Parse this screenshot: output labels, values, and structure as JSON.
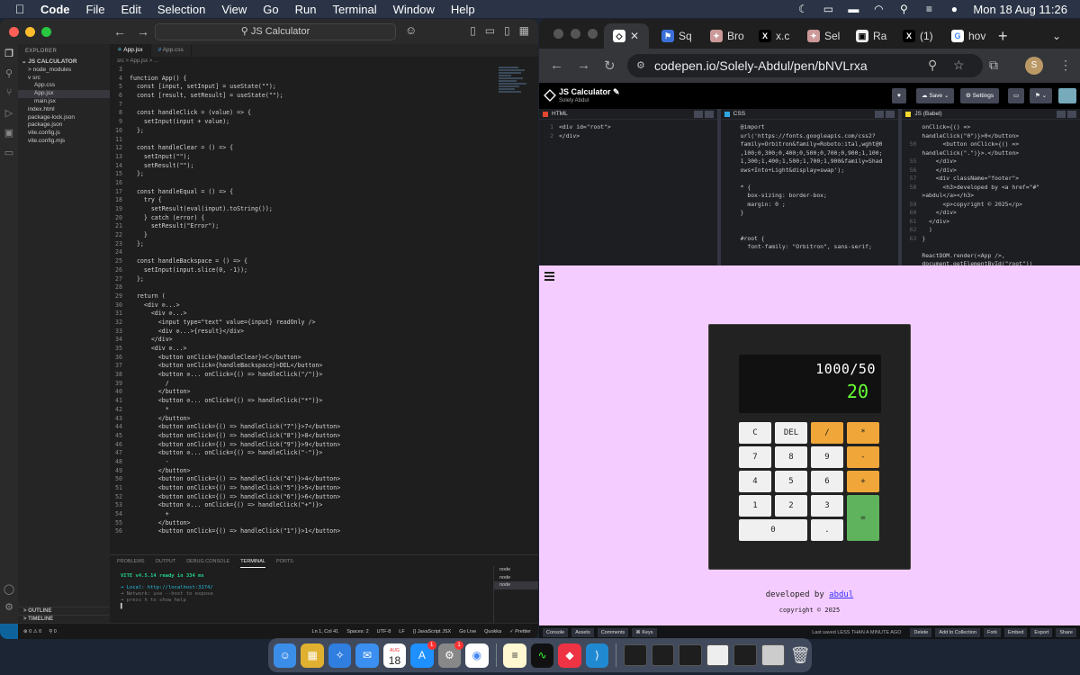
{
  "menubar": {
    "items": [
      "Code",
      "File",
      "Edit",
      "Selection",
      "View",
      "Go",
      "Run",
      "Terminal",
      "Window",
      "Help"
    ],
    "clock": "Mon 18 Aug  11:26"
  },
  "vscode": {
    "search": "JS Calculator",
    "explorer_header": "EXPLORER",
    "project": "JS CALCULATOR",
    "tree": [
      {
        "label": "node_modules",
        "indent": 1,
        "arrow": ">"
      },
      {
        "label": "src",
        "indent": 1,
        "arrow": "v"
      },
      {
        "label": "App.css",
        "indent": 2,
        "arrow": ""
      },
      {
        "label": "App.jsx",
        "indent": 2,
        "arrow": "",
        "active": true
      },
      {
        "label": "main.jsx",
        "indent": 2,
        "arrow": ""
      },
      {
        "label": "index.html",
        "indent": 1,
        "arrow": ""
      },
      {
        "label": "package-lock.json",
        "indent": 1,
        "arrow": ""
      },
      {
        "label": "package.json",
        "indent": 1,
        "arrow": ""
      },
      {
        "label": "vite.config.js",
        "indent": 1,
        "arrow": ""
      },
      {
        "label": "vite.config.mjs",
        "indent": 1,
        "arrow": ""
      }
    ],
    "outline": "OUTLINE",
    "timeline": "TIMELINE",
    "tabs": [
      "App.jsx",
      "App.css"
    ],
    "breadcrumb": "src  >  App.jsx  >  ...",
    "code": [
      {
        "n": "3",
        "t": ""
      },
      {
        "n": "4",
        "t": "function App() {"
      },
      {
        "n": "5",
        "t": "  const [input, setInput] = useState(\"\");"
      },
      {
        "n": "6",
        "t": "  const [result, setResult] = useState(\"\");"
      },
      {
        "n": "7",
        "t": ""
      },
      {
        "n": "8",
        "t": "  const handleClick = (value) => {"
      },
      {
        "n": "9",
        "t": "    setInput(input + value);"
      },
      {
        "n": "10",
        "t": "  };"
      },
      {
        "n": "11",
        "t": ""
      },
      {
        "n": "12",
        "t": "  const handleClear = () => {"
      },
      {
        "n": "13",
        "t": "    setInput(\"\");"
      },
      {
        "n": "14",
        "t": "    setResult(\"\");"
      },
      {
        "n": "15",
        "t": "  };"
      },
      {
        "n": "16",
        "t": ""
      },
      {
        "n": "17",
        "t": "  const handleEqual = () => {"
      },
      {
        "n": "18",
        "t": "    try {"
      },
      {
        "n": "19",
        "t": "      setResult(eval(input).toString());"
      },
      {
        "n": "20",
        "t": "    } catch (error) {"
      },
      {
        "n": "21",
        "t": "      setResult(\"Error\");"
      },
      {
        "n": "22",
        "t": "    }"
      },
      {
        "n": "23",
        "t": "  };"
      },
      {
        "n": "24",
        "t": ""
      },
      {
        "n": "25",
        "t": "  const handleBackspace = () => {"
      },
      {
        "n": "26",
        "t": "    setInput(input.slice(0, -1));"
      },
      {
        "n": "27",
        "t": "  };"
      },
      {
        "n": "28",
        "t": ""
      },
      {
        "n": "29",
        "t": "  return ("
      },
      {
        "n": "30",
        "t": "    <div ⊘...>"
      },
      {
        "n": "31",
        "t": "      <div ⊘...>"
      },
      {
        "n": "32",
        "t": "        <input type=\"text\" value={input} readOnly />"
      },
      {
        "n": "33",
        "t": "        <div ⊘...>{result}</div>"
      },
      {
        "n": "34",
        "t": "      </div>"
      },
      {
        "n": "35",
        "t": "      <div ⊘...>"
      },
      {
        "n": "36",
        "t": "        <button onClick={handleClear}>C</button>"
      },
      {
        "n": "37",
        "t": "        <button onClick={handleBackspace}>DEL</button>"
      },
      {
        "n": "38",
        "t": "        <button ⊘... onClick={() => handleClick(\"/\")}>"
      },
      {
        "n": "39",
        "t": "          /"
      },
      {
        "n": "40",
        "t": "        </button>"
      },
      {
        "n": "41",
        "t": "        <button ⊘... onClick={() => handleClick(\"*\")}>"
      },
      {
        "n": "42",
        "t": "          *"
      },
      {
        "n": "43",
        "t": "        </button>"
      },
      {
        "n": "44",
        "t": "        <button onClick={() => handleClick(\"7\")}>7</button>"
      },
      {
        "n": "45",
        "t": "        <button onClick={() => handleClick(\"8\")}>8</button>"
      },
      {
        "n": "46",
        "t": "        <button onClick={() => handleClick(\"9\")}>9</button>"
      },
      {
        "n": "47",
        "t": "        <button ⊘... onClick={() => handleClick(\"-\")}>"
      },
      {
        "n": "48",
        "t": "          -"
      },
      {
        "n": "49",
        "t": "        </button>"
      },
      {
        "n": "50",
        "t": "        <button onClick={() => handleClick(\"4\")}>4</button>"
      },
      {
        "n": "51",
        "t": "        <button onClick={() => handleClick(\"5\")}>5</button>"
      },
      {
        "n": "52",
        "t": "        <button onClick={() => handleClick(\"6\")}>6</button>"
      },
      {
        "n": "53",
        "t": "        <button ⊘... onClick={() => handleClick(\"+\")}>"
      },
      {
        "n": "54",
        "t": "          +"
      },
      {
        "n": "55",
        "t": "        </button>"
      },
      {
        "n": "56",
        "t": "        <button onClick={() => handleClick(\"1\")}>1</button>"
      }
    ],
    "panel_tabs": [
      "PROBLEMS",
      "OUTPUT",
      "DEBUG CONSOLE",
      "TERMINAL",
      "PORTS"
    ],
    "terminal": {
      "vite": "VITE v4.5.14  ready in 334 ms",
      "local": "➜  Local:   http://localhost:3174/",
      "network": "➜  Network: use --host to expose",
      "help": "➜  press h to show help"
    },
    "terminal_list": [
      "node",
      "node",
      "node"
    ],
    "status_left": [
      "⊗ 0 ⚠ 0",
      "⚲ 0"
    ],
    "status_right": [
      "Ln 1, Col 41",
      "Spaces: 2",
      "UTF-8",
      "LF",
      "{} JavaScript JSX",
      "Go Live",
      "Quokka",
      "✓ Prettier"
    ]
  },
  "chrome": {
    "tabs": [
      "Sq",
      "Bro",
      "x.c",
      "Sel",
      "Ra",
      "(1)",
      "hov"
    ],
    "url": "codepen.io/Solely-Abdul/pen/bNVLrxa",
    "avatar": "S"
  },
  "codepen": {
    "title": "JS Calculator ✎",
    "author": "Solely Abdul",
    "save": "Save",
    "settings": "Settings",
    "panes": [
      {
        "name": "HTML",
        "color": "#e5462f",
        "lines": [
          {
            "n": "1",
            "t": "<div id=\"root\">"
          },
          {
            "n": "2",
            "t": "</div>"
          }
        ]
      },
      {
        "name": "CSS",
        "color": "#2ea8e5",
        "lines": [
          {
            "n": "",
            "t": "@import"
          },
          {
            "n": "",
            "t": "url('https://fonts.googleapis.com/css2?"
          },
          {
            "n": "",
            "t": "family=Orbitron&family=Roboto:ital,wght@0"
          },
          {
            "n": "",
            "t": ",100;0,300;0,400;0,500;0,700;0,900;1,100;"
          },
          {
            "n": "",
            "t": "1,300;1,400;1,500;1,700;1,900&family=Shad"
          },
          {
            "n": "",
            "t": "ows+Into+Light&display=swap');"
          },
          {
            "n": "",
            "t": ""
          },
          {
            "n": "",
            "t": "* {"
          },
          {
            "n": "",
            "t": "  box-sizing: border-box;"
          },
          {
            "n": "",
            "t": "  margin: 0 ;"
          },
          {
            "n": "",
            "t": "}"
          },
          {
            "n": "",
            "t": ""
          },
          {
            "n": "",
            "t": ""
          },
          {
            "n": "",
            "t": "#root {"
          },
          {
            "n": "",
            "t": "  font-family: \"Orbitron\", sans-serif;"
          }
        ]
      },
      {
        "name": "JS (Babel)",
        "color": "#f5d82d",
        "lines": [
          {
            "n": "",
            "t": "onClick={() =>"
          },
          {
            "n": "",
            "t": "handleClick(\"0\")}>0</button>"
          },
          {
            "n": "50",
            "t": "      <button onClick={() =>"
          },
          {
            "n": "",
            "t": "handleClick(\".\")}>.</button>"
          },
          {
            "n": "55",
            "t": "    </div>"
          },
          {
            "n": "56",
            "t": "    </div>"
          },
          {
            "n": "57",
            "t": "    <div className=\"footer\">"
          },
          {
            "n": "58",
            "t": "      <h3>developed by <a href=\"#\""
          },
          {
            "n": "",
            "t": ">abdul</a></h3>"
          },
          {
            "n": "59",
            "t": "      <p>copyright © 2025</p>"
          },
          {
            "n": "60",
            "t": "    </div>"
          },
          {
            "n": "61",
            "t": "  </div>"
          },
          {
            "n": "62",
            "t": "  )"
          },
          {
            "n": "63",
            "t": "}"
          },
          {
            "n": "",
            "t": ""
          },
          {
            "n": "",
            "t": "ReactDOM.render(<App />,"
          },
          {
            "n": "",
            "t": "document.getElementById(\"root\"))"
          }
        ]
      }
    ],
    "calc": {
      "input": "1000/50",
      "result": "20",
      "keys": [
        {
          "label": "C",
          "kind": "num"
        },
        {
          "label": "DEL",
          "kind": "num"
        },
        {
          "label": "/",
          "kind": "op"
        },
        {
          "label": "*",
          "kind": "op"
        },
        {
          "label": "7",
          "kind": "num"
        },
        {
          "label": "8",
          "kind": "num"
        },
        {
          "label": "9",
          "kind": "num"
        },
        {
          "label": "-",
          "kind": "op"
        },
        {
          "label": "4",
          "kind": "num"
        },
        {
          "label": "5",
          "kind": "num"
        },
        {
          "label": "6",
          "kind": "num"
        },
        {
          "label": "+",
          "kind": "op"
        },
        {
          "label": "1",
          "kind": "num"
        },
        {
          "label": "2",
          "kind": "num"
        },
        {
          "label": "3",
          "kind": "num"
        },
        {
          "label": "=",
          "kind": "eq"
        },
        {
          "label": "0",
          "kind": "zero"
        },
        {
          "label": ".",
          "kind": "num"
        }
      ]
    },
    "footer_dev": "developed by",
    "footer_link": "abdul",
    "footer_copy": "copyright © 2025",
    "bottom_left": [
      "Console",
      "Assets",
      "Comments",
      "⌘ Keys"
    ],
    "last_saved": "Last saved LESS THAN A MINUTE AGO",
    "bottom_right": [
      "Delete",
      "Add to Collection",
      "Fork",
      "Embed",
      "Export",
      "Share"
    ]
  },
  "dock": {
    "calendar_month": "AUG",
    "calendar_day": "18",
    "badge_mail": "1",
    "badge_settings": "1"
  }
}
